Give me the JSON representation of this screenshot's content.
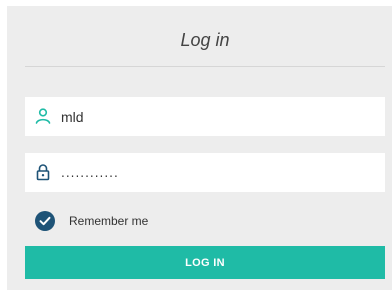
{
  "form": {
    "title": "Log in",
    "username": {
      "value": "mld",
      "icon": "user-icon"
    },
    "password": {
      "value": "............",
      "icon": "lock-icon"
    },
    "remember": {
      "label": "Remember me",
      "checked": true
    },
    "submit_label": "LOG IN"
  },
  "colors": {
    "panel_bg": "#ededed",
    "accent": "#1fbba6",
    "user_icon": "#1fbba6",
    "lock_icon": "#1e5377",
    "checkbox": "#1e5377"
  }
}
